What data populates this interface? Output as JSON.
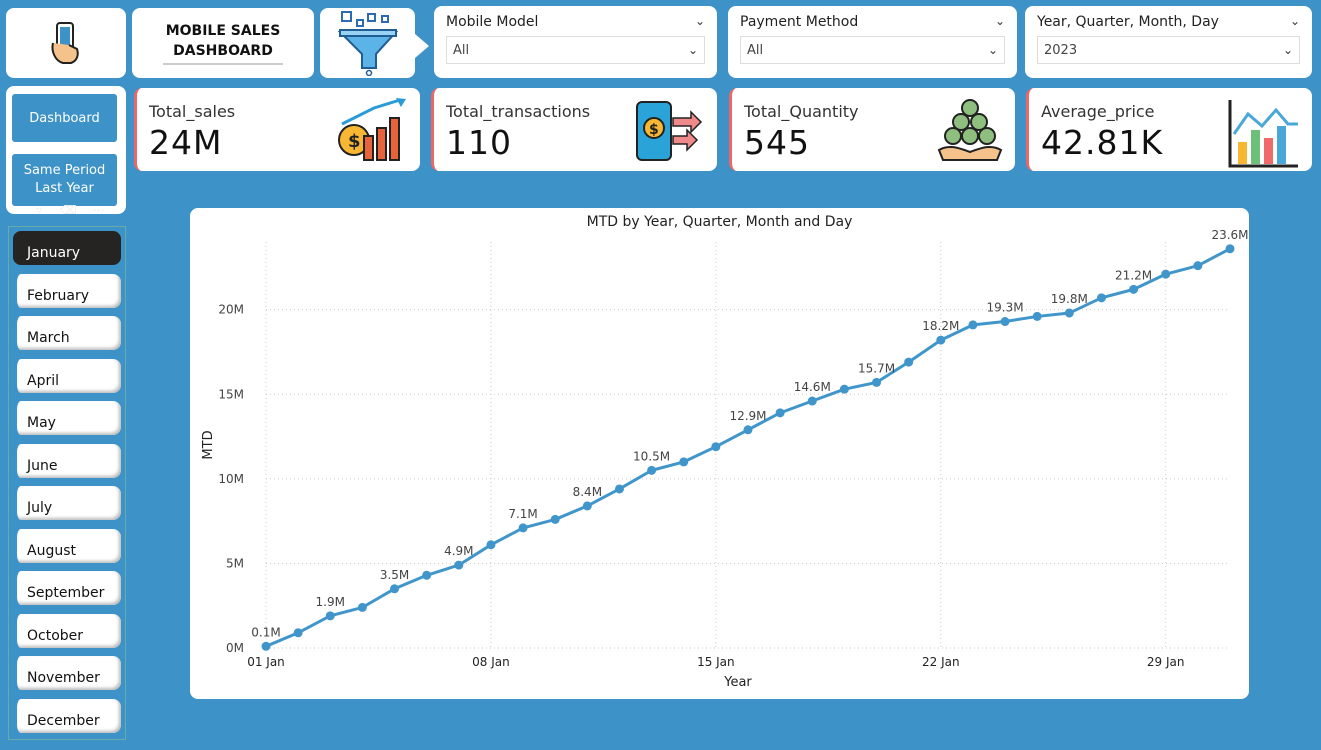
{
  "header": {
    "title_line1": "MOBILE SALES",
    "title_line2": "DASHBOARD"
  },
  "slicers": [
    {
      "label": "Mobile Model",
      "value": "All"
    },
    {
      "label": "Payment Method",
      "value": "All"
    },
    {
      "label": "Year, Quarter, Month, Day",
      "value": "2023"
    }
  ],
  "kpis": [
    {
      "label": "Total_sales",
      "value": "24M",
      "icon": "money-growth-icon"
    },
    {
      "label": "Total_transactions",
      "value": "110",
      "icon": "mobile-payment-icon"
    },
    {
      "label": "Total_Quantity",
      "value": "545",
      "icon": "coins-hand-icon"
    },
    {
      "label": "Average_price",
      "value": "42.81K",
      "icon": "bar-chart-icon"
    }
  ],
  "nav": {
    "dashboard": "Dashboard",
    "same_period_line1": "Same Period",
    "same_period_line2": "Last Year"
  },
  "months": [
    "January",
    "February",
    "March",
    "April",
    "May",
    "June",
    "July",
    "August",
    "September",
    "October",
    "November",
    "December"
  ],
  "selected_month": "January",
  "chart_data": {
    "type": "line",
    "title": "MTD by Year, Quarter, Month and Day",
    "xlabel": "Year",
    "ylabel": "MTD",
    "x_tick_labels": [
      "01 Jan",
      "08 Jan",
      "15 Jan",
      "22 Jan",
      "29 Jan"
    ],
    "y_tick_labels": [
      "0M",
      "5M",
      "10M",
      "15M",
      "20M"
    ],
    "ylim": [
      0,
      24
    ],
    "x": [
      1,
      2,
      3,
      4,
      5,
      6,
      7,
      8,
      9,
      10,
      11,
      12,
      13,
      14,
      15,
      16,
      17,
      18,
      19,
      20,
      21,
      22,
      23,
      24,
      25,
      26,
      27,
      28,
      29,
      30,
      31
    ],
    "values": [
      0.1,
      0.9,
      1.9,
      2.4,
      3.5,
      4.3,
      4.9,
      6.1,
      7.1,
      7.6,
      8.4,
      9.4,
      10.5,
      11.0,
      11.9,
      12.9,
      13.9,
      14.6,
      15.3,
      15.7,
      16.9,
      18.2,
      19.1,
      19.3,
      19.6,
      19.8,
      20.7,
      21.2,
      22.1,
      22.6,
      23.6
    ],
    "data_labels": {
      "1": "0.1M",
      "3": "1.9M",
      "5": "3.5M",
      "7": "4.9M",
      "9": "7.1M",
      "11": "8.4M",
      "13": "10.5M",
      "16": "12.9M",
      "18": "14.6M",
      "20": "15.7M",
      "22": "18.2M",
      "24": "19.3M",
      "26": "19.8M",
      "28": "21.2M",
      "31": "23.6M"
    },
    "color": "#4096cb",
    "grid": true
  }
}
